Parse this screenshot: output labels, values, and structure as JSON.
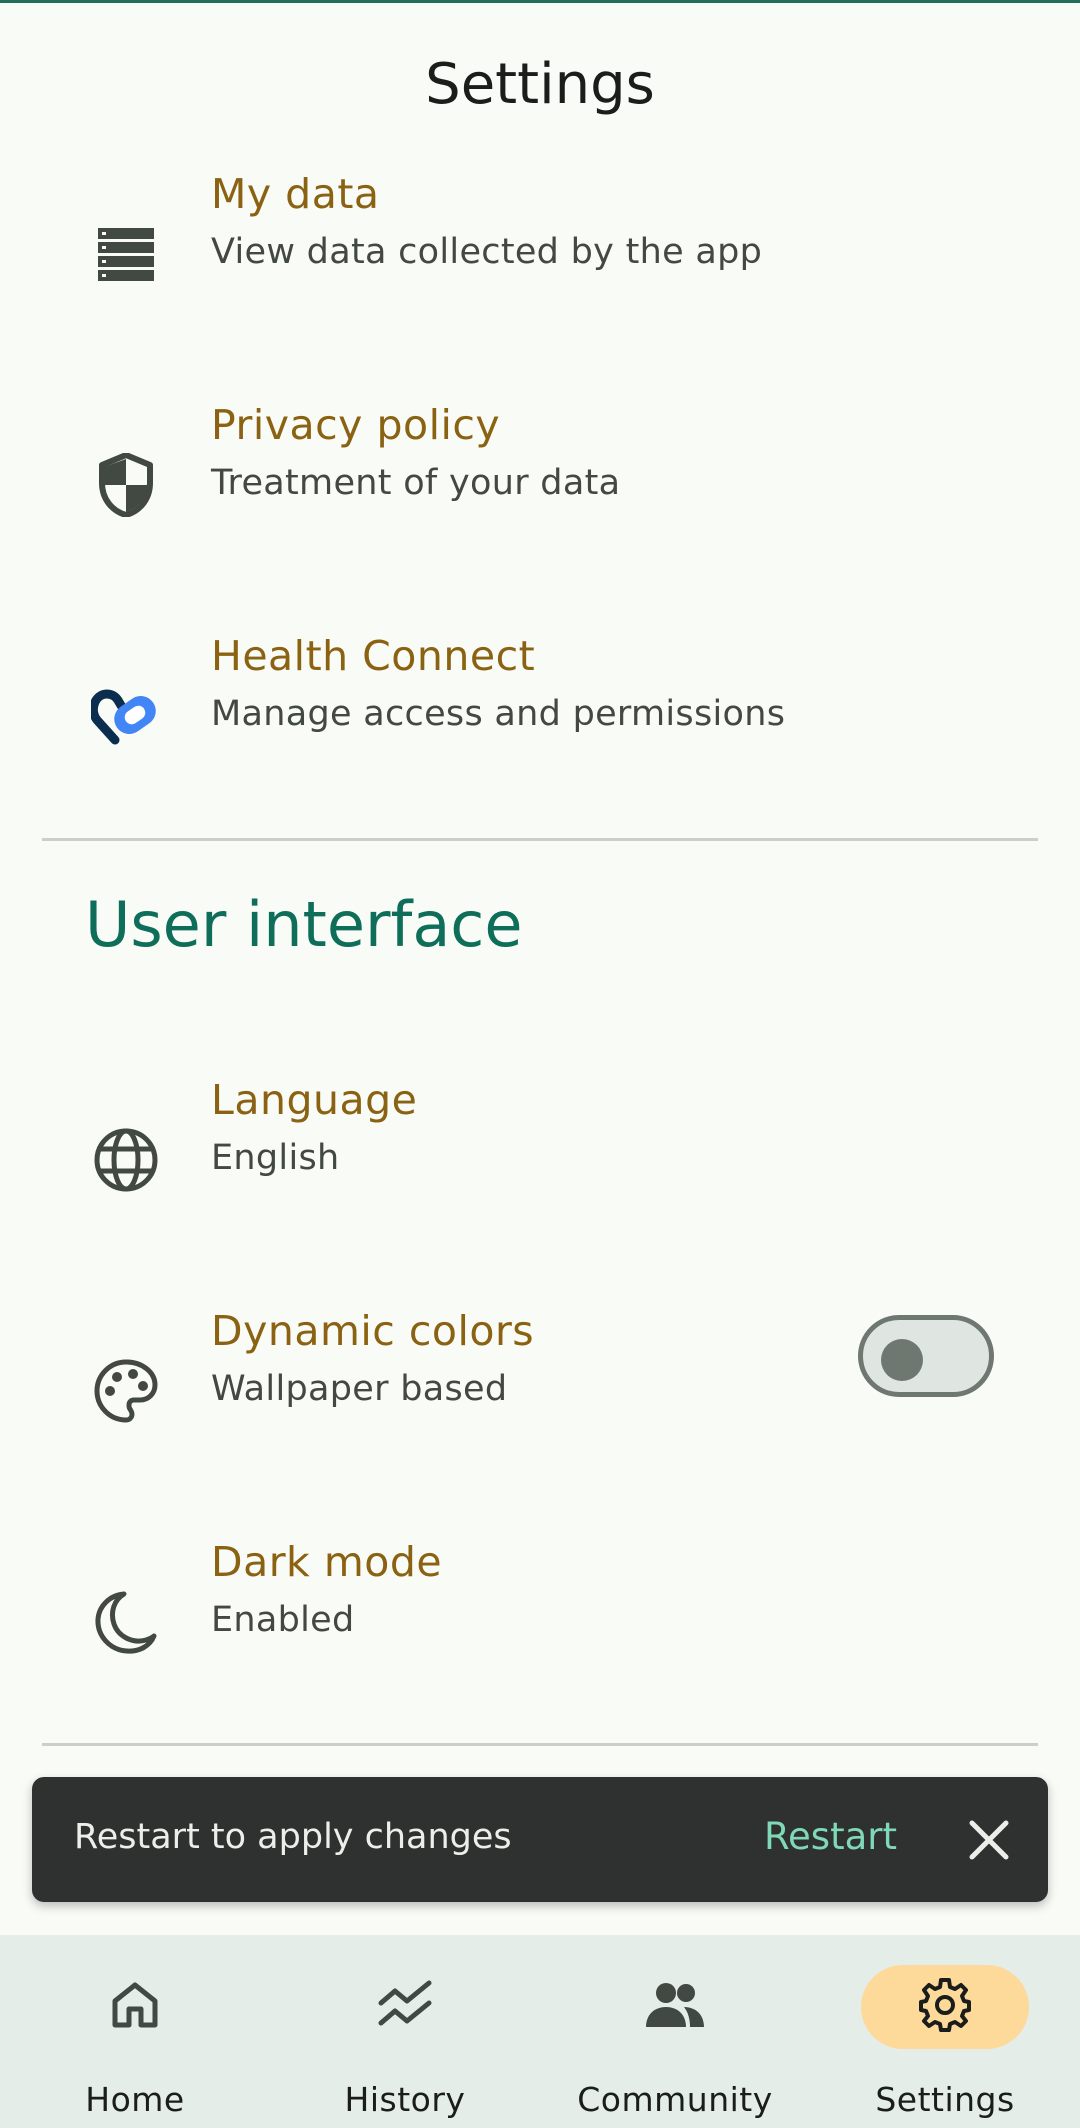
{
  "header": {
    "title": "Settings"
  },
  "items": [
    {
      "label": "My data",
      "sub": "View data collected by the app",
      "icon": "storage-icon"
    },
    {
      "label": "Privacy policy",
      "sub": "Treatment of your data",
      "icon": "shield-icon"
    },
    {
      "label": "Health Connect",
      "sub": "Manage access and permissions",
      "icon": "health-connect-icon"
    }
  ],
  "user_interface": {
    "title": "User interface",
    "items": [
      {
        "label": "Language",
        "sub": "English",
        "icon": "globe-icon"
      },
      {
        "label": "Dynamic colors",
        "sub": "Wallpaper based",
        "icon": "palette-icon",
        "toggle_on": false
      },
      {
        "label": "Dark mode",
        "sub": "Enabled",
        "icon": "moon-icon"
      }
    ]
  },
  "snackbar": {
    "message": "Restart to apply changes",
    "action": "Restart",
    "close_icon": "close-icon"
  },
  "nav": [
    {
      "label": "Home",
      "icon": "home-icon",
      "active": false
    },
    {
      "label": "History",
      "icon": "history-icon",
      "active": false
    },
    {
      "label": "Community",
      "icon": "people-icon",
      "active": false
    },
    {
      "label": "Settings",
      "icon": "gear-icon",
      "active": true
    }
  ],
  "colors": {
    "accent": "#0f6e5a",
    "item_label": "#8a6212",
    "snackbar_action": "#7fd8b7",
    "nav_active": "#fdd99a",
    "background": "#f9fbf7"
  }
}
